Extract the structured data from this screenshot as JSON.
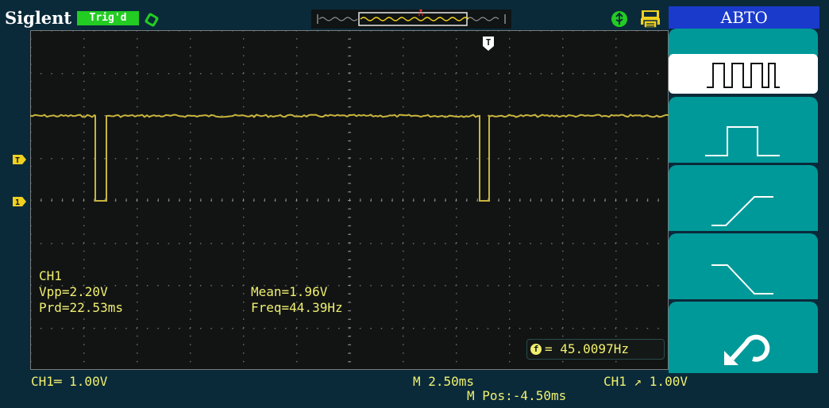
{
  "header": {
    "brand": "Siglent",
    "trigger_status": "Trig'd"
  },
  "menu": {
    "title": "АВТО",
    "items": [
      {
        "icon": "multi-pulse-icon",
        "selected": true
      },
      {
        "icon": "single-pulse-icon",
        "selected": false
      },
      {
        "icon": "rising-edge-icon",
        "selected": false
      },
      {
        "icon": "falling-edge-icon",
        "selected": false
      },
      {
        "icon": "undo-arrow-icon",
        "selected": false
      }
    ]
  },
  "markers": {
    "trigger_top": "T",
    "trigger_left": "T",
    "channel_left": "1"
  },
  "measurements": {
    "channel": "CH1",
    "vpp": "Vpp=2.20V",
    "prd": "Prd=22.53ms",
    "mean": "Mean=1.96V",
    "freq": "Freq=44.39Hz"
  },
  "counter": {
    "icon_letter": "f",
    "value": "= 45.0097Hz"
  },
  "status": {
    "ch1_scale": "CH1═ 1.00V",
    "timebase": "M 2.50ms",
    "trigger": "CH1 ↗ 1.00V",
    "mpos": "M Pos:-4.50ms"
  },
  "colors": {
    "trace": "#c8b43c",
    "text": "#f0f070",
    "menu_button": "#009999",
    "menu_title": "#1a3acc"
  }
}
